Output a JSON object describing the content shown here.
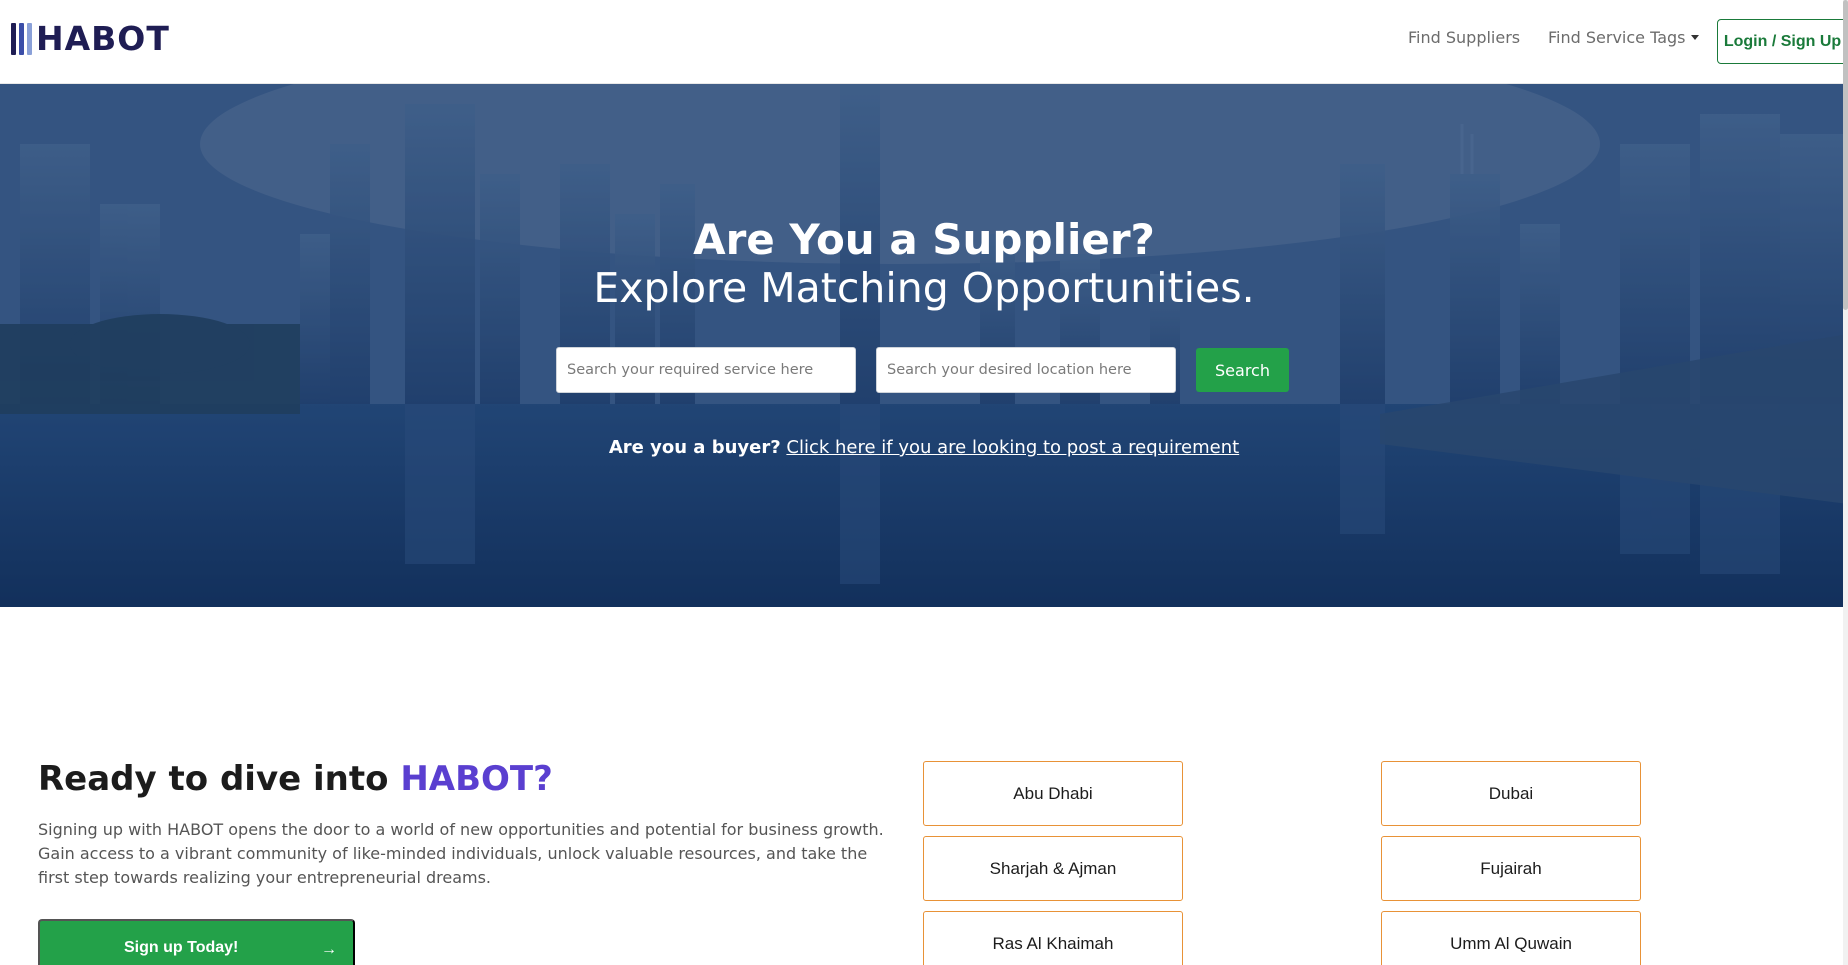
{
  "header": {
    "logo_text": "HABOT",
    "logo_bar_colors": [
      "#1f1d54",
      "#3b4ea8",
      "#8aa0d8"
    ],
    "nav": {
      "find_suppliers": "Find Suppliers",
      "find_service_tags": "Find Service Tags"
    },
    "login_label": "Login / Sign Up"
  },
  "hero": {
    "title": "Are You a Supplier?",
    "subtitle": "Explore Matching Opportunities.",
    "service_placeholder": "Search your required service here",
    "location_placeholder": "Search your desired location here",
    "service_value": "",
    "location_value": "",
    "search_label": "Search",
    "buyer_question": "Are you a buyer?",
    "buyer_link": "Click here if you are looking to post a requirement"
  },
  "ready": {
    "title_prefix": "Ready to dive into ",
    "title_brand": "HABOT?",
    "description": "Signing up with HABOT opens the door to a world of new opportunities and potential for business growth. Gain access to a vibrant community of like-minded individuals, unlock valuable resources, and take the first step towards realizing your entrepreneurial dreams.",
    "signup_label": "Sign up Today!",
    "signup_icon": "arrow-right-icon"
  },
  "locations": [
    "Abu Dhabi",
    "Dubai",
    "Sharjah & Ajman",
    "Fujairah",
    "Ras Al Khaimah",
    "Umm Al Quwain"
  ],
  "colors": {
    "brand_green": "#23a149",
    "brand_purple": "#5a3fd0",
    "location_border": "#e89237",
    "login_green": "#1a7a3a"
  }
}
